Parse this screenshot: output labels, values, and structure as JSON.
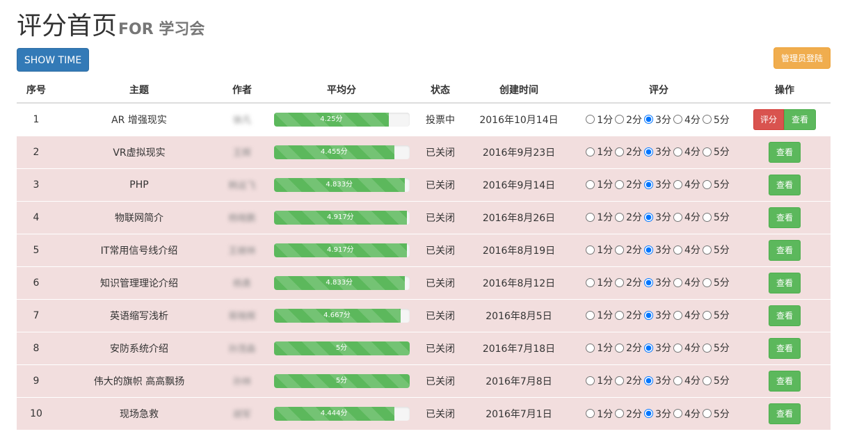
{
  "header": {
    "title": "评分首页",
    "subtitle": "FOR 学习会"
  },
  "toolbar": {
    "show_time_label": "SHOW TIME",
    "admin_login_label": "管理员登陆"
  },
  "table": {
    "columns": [
      "序号",
      "主题",
      "作者",
      "平均分",
      "状态",
      "创建时间",
      "评分",
      "操作"
    ],
    "rating_options": [
      "1分",
      "2分",
      "3分",
      "4分",
      "5分"
    ],
    "rate_label": "评分",
    "view_label": "查看",
    "rows": [
      {
        "index": "1",
        "topic": "AR 增强现实",
        "author": "徐凡",
        "score": 4.25,
        "score_label": "4.25分",
        "status": "投票中",
        "created": "2016年10月14日",
        "selected_rating": "3分",
        "active": true
      },
      {
        "index": "2",
        "topic": "VR虚拟现实",
        "author": "王辉",
        "score": 4.455,
        "score_label": "4.455分",
        "status": "已关闭",
        "created": "2016年9月23日",
        "selected_rating": "3分",
        "active": false
      },
      {
        "index": "3",
        "topic": "PHP",
        "author": "韩运飞",
        "score": 4.833,
        "score_label": "4.833分",
        "status": "已关闭",
        "created": "2016年9月14日",
        "selected_rating": "3分",
        "active": false
      },
      {
        "index": "4",
        "topic": "物联网简介",
        "author": "杨晓鹏",
        "score": 4.917,
        "score_label": "4.917分",
        "status": "已关闭",
        "created": "2016年8月26日",
        "selected_rating": "3分",
        "active": false
      },
      {
        "index": "5",
        "topic": "IT常用信号线介绍",
        "author": "王继林",
        "score": 4.917,
        "score_label": "4.917分",
        "status": "已关闭",
        "created": "2016年8月19日",
        "selected_rating": "3分",
        "active": false
      },
      {
        "index": "6",
        "topic": "知识管理理论介绍",
        "author": "杨勇",
        "score": 4.833,
        "score_label": "4.833分",
        "status": "已关闭",
        "created": "2016年8月12日",
        "selected_rating": "3分",
        "active": false
      },
      {
        "index": "7",
        "topic": "英语缩写浅析",
        "author": "蒋晓辉",
        "score": 4.667,
        "score_label": "4.667分",
        "status": "已关闭",
        "created": "2016年8月5日",
        "selected_rating": "3分",
        "active": false
      },
      {
        "index": "8",
        "topic": "安防系统介绍",
        "author": "孙茂森",
        "score": 5,
        "score_label": "5分",
        "status": "已关闭",
        "created": "2016年7月18日",
        "selected_rating": "3分",
        "active": false
      },
      {
        "index": "9",
        "topic": "伟大的旗帜 高高飘扬",
        "author": "孙林",
        "score": 5,
        "score_label": "5分",
        "status": "已关闭",
        "created": "2016年7月8日",
        "selected_rating": "3分",
        "active": false
      },
      {
        "index": "10",
        "topic": "现场急救",
        "author": "胡军",
        "score": 4.444,
        "score_label": "4.444分",
        "status": "已关闭",
        "created": "2016年7月1日",
        "selected_rating": "3分",
        "active": false
      }
    ]
  },
  "colors": {
    "primary": "#337ab7",
    "warning": "#f0ad4e",
    "success": "#5cb85c",
    "danger": "#d9534f",
    "row_closed_bg": "#f2dede"
  },
  "icons": {
    "progress_bar": "striped-progress-bar",
    "radio": "radio-button"
  }
}
